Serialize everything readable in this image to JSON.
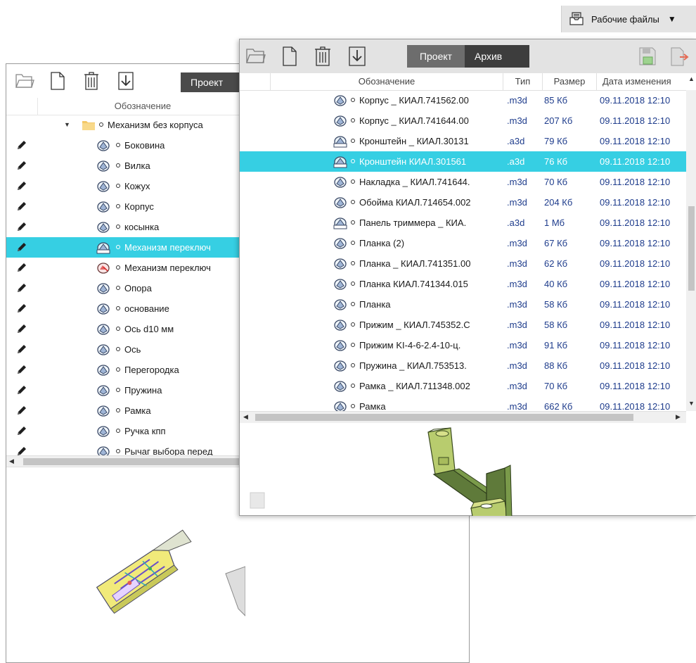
{
  "workfiles": {
    "label": "Рабочие файлы",
    "arrow": "▼",
    "icon": "inbox-tray-icon"
  },
  "back_window": {
    "tab_label": "Проект",
    "column_name": "Обозначение",
    "root_label": "Механизм без корпуса",
    "items": [
      {
        "label": "Боковина",
        "icon": "part-icon",
        "pencil": true
      },
      {
        "label": "Вилка",
        "icon": "part-icon",
        "pencil": true
      },
      {
        "label": "Кожух",
        "icon": "part-icon",
        "pencil": true
      },
      {
        "label": "Корпус",
        "icon": "part-icon",
        "pencil": true
      },
      {
        "label": "косынка",
        "icon": "part-icon",
        "pencil": true
      },
      {
        "label": "Механизм переключ",
        "icon": "assembly-icon",
        "pencil": true,
        "selected": true
      },
      {
        "label": "Механизм переключ",
        "icon": "drawing-icon",
        "pencil": true
      },
      {
        "label": "Опора",
        "icon": "part-icon",
        "pencil": true
      },
      {
        "label": "основание",
        "icon": "part-icon",
        "pencil": true
      },
      {
        "label": "Ось d10 мм",
        "icon": "part-icon",
        "pencil": true
      },
      {
        "label": "Ось",
        "icon": "part-icon",
        "pencil": true
      },
      {
        "label": "Перегородка",
        "icon": "part-icon",
        "pencil": true
      },
      {
        "label": "Пружина",
        "icon": "part-icon",
        "pencil": true
      },
      {
        "label": "Рамка",
        "icon": "part-icon",
        "pencil": true
      },
      {
        "label": "Ручка кпп",
        "icon": "part-icon",
        "pencil": true
      },
      {
        "label": "Рычаг выбора перед",
        "icon": "part-icon",
        "pencil": true
      }
    ]
  },
  "front_window": {
    "tabs": [
      "Проект",
      "Архив"
    ],
    "columns": [
      "Обозначение",
      "Тип",
      "Размер",
      "Дата изменения"
    ],
    "rows": [
      {
        "name": "Корпус _ КИАЛ.741562.00",
        "type": ".m3d",
        "size": "85 Кб",
        "date": "09.11.2018 12:10",
        "icon": "part-icon"
      },
      {
        "name": "Корпус _ КИАЛ.741644.00",
        "type": ".m3d",
        "size": "207 Кб",
        "date": "09.11.2018 12:10",
        "icon": "part-icon"
      },
      {
        "name": "Кронштейн _ КИАЛ.30131",
        "type": ".a3d",
        "size": "79 Кб",
        "date": "09.11.2018 12:10",
        "icon": "assembly-icon"
      },
      {
        "name": "Кронштейн КИАЛ.301561",
        "type": ".a3d",
        "size": "76 Кб",
        "date": "09.11.2018 12:10",
        "icon": "assembly-icon",
        "selected": true
      },
      {
        "name": "Накладка _ КИАЛ.741644.",
        "type": ".m3d",
        "size": "70 Кб",
        "date": "09.11.2018 12:10",
        "icon": "part-icon"
      },
      {
        "name": "Обойма КИАЛ.714654.002",
        "type": ".m3d",
        "size": "204 Кб",
        "date": "09.11.2018 12:10",
        "icon": "part-icon"
      },
      {
        "name": "Панель триммера _ КИА.",
        "type": ".a3d",
        "size": "1 Мб",
        "date": "09.11.2018 12:10",
        "icon": "assembly-icon"
      },
      {
        "name": "Планка (2)",
        "type": ".m3d",
        "size": "67 Кб",
        "date": "09.11.2018 12:10",
        "icon": "part-icon"
      },
      {
        "name": "Планка _ КИАЛ.741351.00",
        "type": ".m3d",
        "size": "62 Кб",
        "date": "09.11.2018 12:10",
        "icon": "part-icon"
      },
      {
        "name": "Планка КИАЛ.741344.015",
        "type": ".m3d",
        "size": "40 Кб",
        "date": "09.11.2018 12:10",
        "icon": "part-icon"
      },
      {
        "name": "Планка",
        "type": ".m3d",
        "size": "58 Кб",
        "date": "09.11.2018 12:10",
        "icon": "part-icon"
      },
      {
        "name": "Прижим _ КИАЛ.745352.С",
        "type": ".m3d",
        "size": "58 Кб",
        "date": "09.11.2018 12:10",
        "icon": "part-icon"
      },
      {
        "name": "Прижим KI-4-6-2.4-10-ц.",
        "type": ".m3d",
        "size": "91 Кб",
        "date": "09.11.2018 12:10",
        "icon": "part-icon"
      },
      {
        "name": "Пружина _ КИАЛ.753513.",
        "type": ".m3d",
        "size": "88 Кб",
        "date": "09.11.2018 12:10",
        "icon": "part-icon"
      },
      {
        "name": "Рамка _ КИАЛ.711348.002",
        "type": ".m3d",
        "size": "70 Кб",
        "date": "09.11.2018 12:10",
        "icon": "part-icon"
      },
      {
        "name": "Рамка",
        "type": ".m3d",
        "size": "662 Кб",
        "date": "09.11.2018 12:10",
        "icon": "part-icon"
      }
    ]
  },
  "colors": {
    "selection": "#36cfe3",
    "meta_text": "#1e3c8c",
    "tab_dark": "#3d3d3d"
  }
}
